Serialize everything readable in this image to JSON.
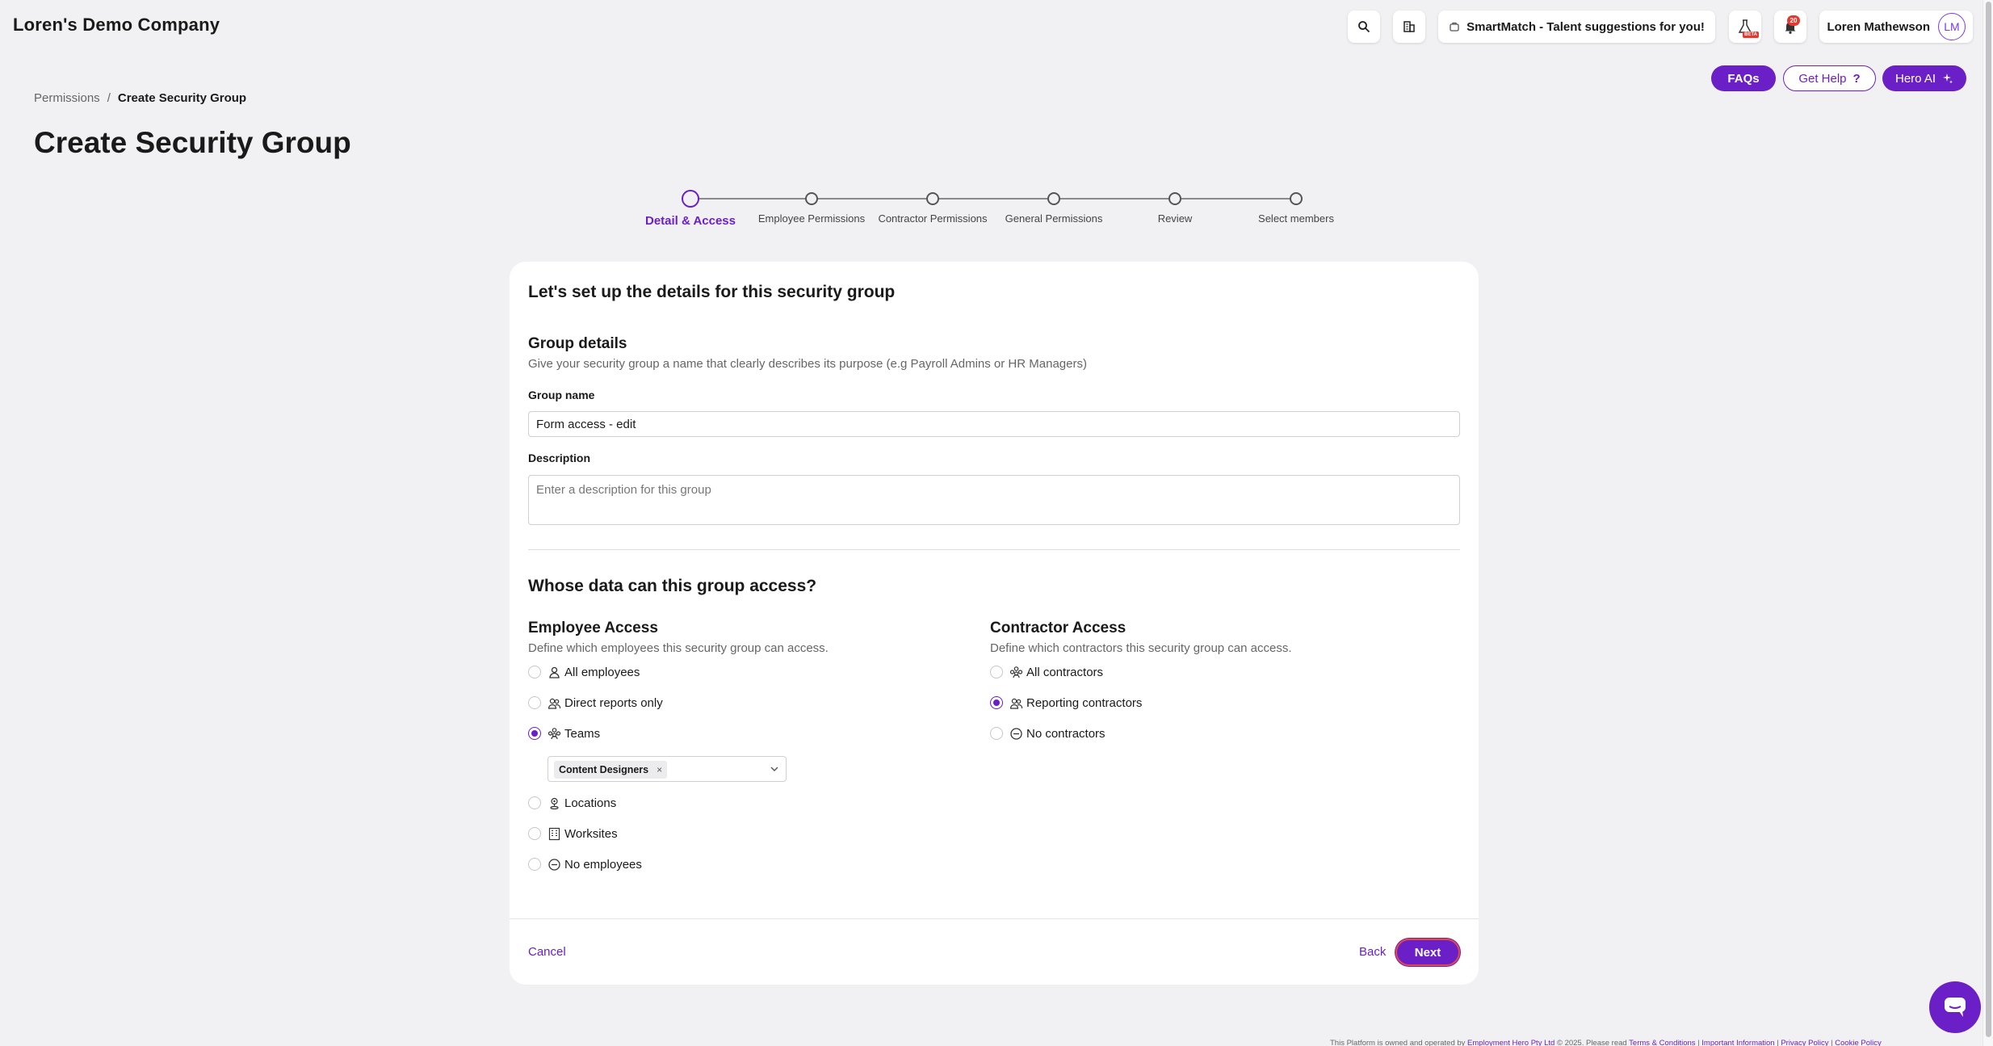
{
  "header": {
    "company": "Loren's Demo Company",
    "smartmatch_label": "SmartMatch - Talent suggestions for you!",
    "beta_badge": "BETA",
    "notification_count": "20",
    "user_name": "Loren Mathewson",
    "user_initials": "LM"
  },
  "help": {
    "faqs": "FAQs",
    "get_help": "Get Help",
    "get_help_icon": "?",
    "hero_ai": "Hero AI"
  },
  "breadcrumb": {
    "parent": "Permissions",
    "separator": "/",
    "current": "Create Security Group"
  },
  "page_title": "Create Security Group",
  "steps": [
    {
      "label": "Detail & Access"
    },
    {
      "label": "Employee Permissions"
    },
    {
      "label": "Contractor Permissions"
    },
    {
      "label": "General Permissions"
    },
    {
      "label": "Review"
    },
    {
      "label": "Select members"
    }
  ],
  "form": {
    "title": "Let's set up the details for this security group",
    "group_details_title": "Group details",
    "group_details_sub": "Give your security group a name that clearly describes its purpose (e.g Payroll Admins or HR Managers)",
    "group_name_label": "Group name",
    "group_name_value": "Form access - edit",
    "description_label": "Description",
    "description_placeholder": "Enter a description for this group",
    "access_title": "Whose data can this group access?",
    "employee": {
      "title": "Employee Access",
      "sub": "Define which employees this security group can access.",
      "options": [
        "All employees",
        "Direct reports only",
        "Teams",
        "Locations",
        "Worksites",
        "No employees"
      ],
      "selected": "Teams",
      "teams_chip": "Content Designers",
      "chip_remove": "×"
    },
    "contractor": {
      "title": "Contractor Access",
      "sub": "Define which contractors this security group can access.",
      "options": [
        "All contractors",
        "Reporting contractors",
        "No contractors"
      ],
      "selected": "Reporting contractors"
    },
    "cancel": "Cancel",
    "back": "Back",
    "next": "Next"
  },
  "footer": {
    "text": "This Platform is owned and operated by",
    "company_link": "Employment Hero Pty Ltd",
    "copyright": "© 2025. Please read",
    "terms": "Terms & Conditions",
    "important": "Important Information",
    "privacy": "Privacy Policy",
    "cookie": "Cookie Policy"
  },
  "colors": {
    "accent": "#6a1fc7",
    "background": "#f1f1f4",
    "next_outline": "#e24a4a"
  }
}
